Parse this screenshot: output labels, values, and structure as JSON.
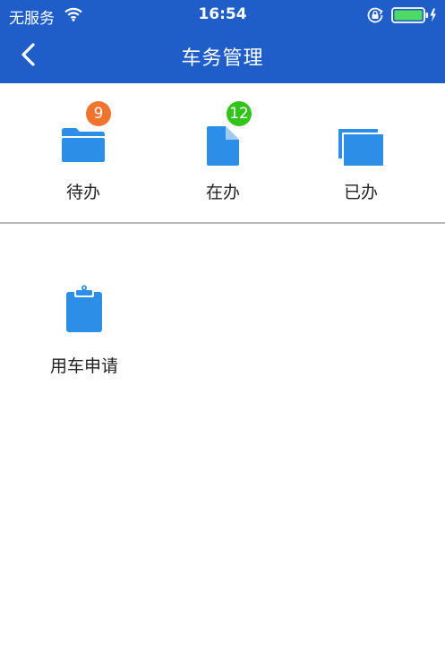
{
  "status_bar": {
    "carrier": "无服务",
    "time": "16:54",
    "icons": [
      "wifi-icon",
      "rotation-lock-icon",
      "battery-charging-icon"
    ]
  },
  "nav": {
    "title": "车务管理",
    "back_icon": "chevron-left-icon"
  },
  "tabs": [
    {
      "label": "待办",
      "badge": "9",
      "badge_color": "#f0732e",
      "icon": "folder-icon"
    },
    {
      "label": "在办",
      "badge": "12",
      "badge_color": "#34c31c",
      "icon": "document-icon"
    },
    {
      "label": "已办",
      "icon": "stacked-windows-icon"
    }
  ],
  "apps": [
    {
      "label": "用车申请",
      "icon": "clipboard-icon"
    }
  ],
  "colors": {
    "header": "#1f5dc9",
    "icon_blue": "#2d8ee8",
    "battery": "#4cd964"
  }
}
